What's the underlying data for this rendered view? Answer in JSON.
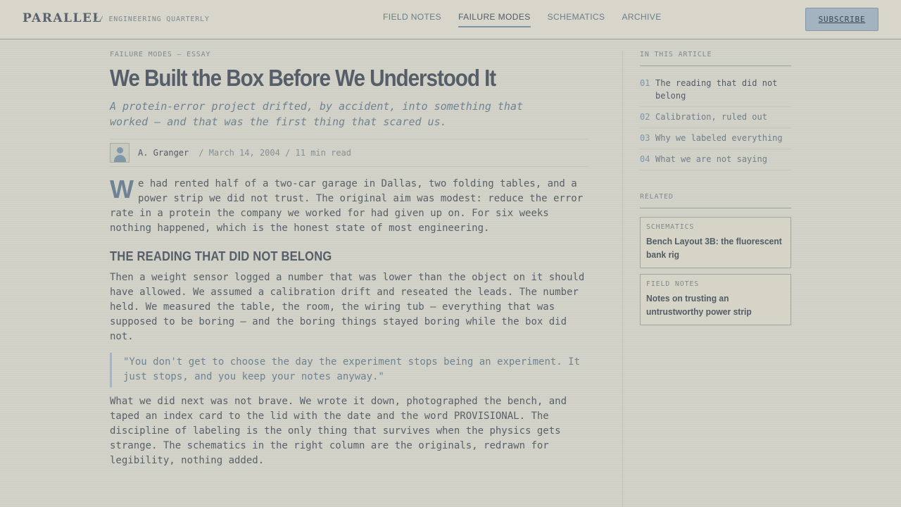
{
  "header": {
    "logo": "PARALLEL",
    "tagline": "// ENGINEERING QUARTERLY",
    "nav": [
      "FIELD NOTES",
      "FAILURE MODES",
      "SCHEMATICS",
      "ARCHIVE"
    ],
    "active_nav": "FAILURE MODES",
    "subscribe_label": "SUBSCRIBE"
  },
  "article": {
    "kicker": "FAILURE MODES — ESSAY",
    "title": "We Built the Box Before We Understood It",
    "dek": "A protein-error project drifted, by accident, into something that worked — and that was the first thing that scared us.",
    "author": "A. Granger",
    "meta": "/ March 14, 2004 / 11 min read",
    "dropcap": "W",
    "lead": "e had rented half of a two-car garage in Dallas, two folding tables, and a power strip we did not trust. The original aim was modest: reduce the error rate in a protein the company we worked for had given up on. For six weeks nothing happened, which is the honest state of most engineering.",
    "section_heading": "THE READING THAT DID NOT BELONG",
    "paragraph_2": "Then a weight sensor logged a number that was lower than the object on it should have allowed. We assumed a calibration drift and reseated the leads. The number held. We measured the table, the room, the wiring tub — everything that was supposed to be boring — and the boring things stayed boring while the box did not.",
    "quote": "\"You don't get to choose the day the experiment stops being an experiment. It just stops, and you keep your notes anyway.\"",
    "paragraph_3": "What we did next was not brave. We wrote it down, photographed the bench, and taped an index card to the lid with the date and the word PROVISIONAL. The discipline of labeling is the only thing that survives when the physics gets strange. The schematics in the right column are the originals, redrawn for legibility, nothing added."
  },
  "sidebar": {
    "toc_label": "IN THIS ARTICLE",
    "toc": [
      {
        "num": "01",
        "label": "The reading that did not belong"
      },
      {
        "num": "02",
        "label": "Calibration, ruled out"
      },
      {
        "num": "03",
        "label": "Why we labeled everything"
      },
      {
        "num": "04",
        "label": "What we are not saying"
      }
    ],
    "related_label": "RELATED",
    "related": [
      {
        "category": "SCHEMATICS",
        "title": "Bench Layout 3B: the fluorescent bank rig"
      },
      {
        "category": "FIELD NOTES",
        "title": "Notes on trusting an untrustworthy power strip"
      }
    ]
  }
}
